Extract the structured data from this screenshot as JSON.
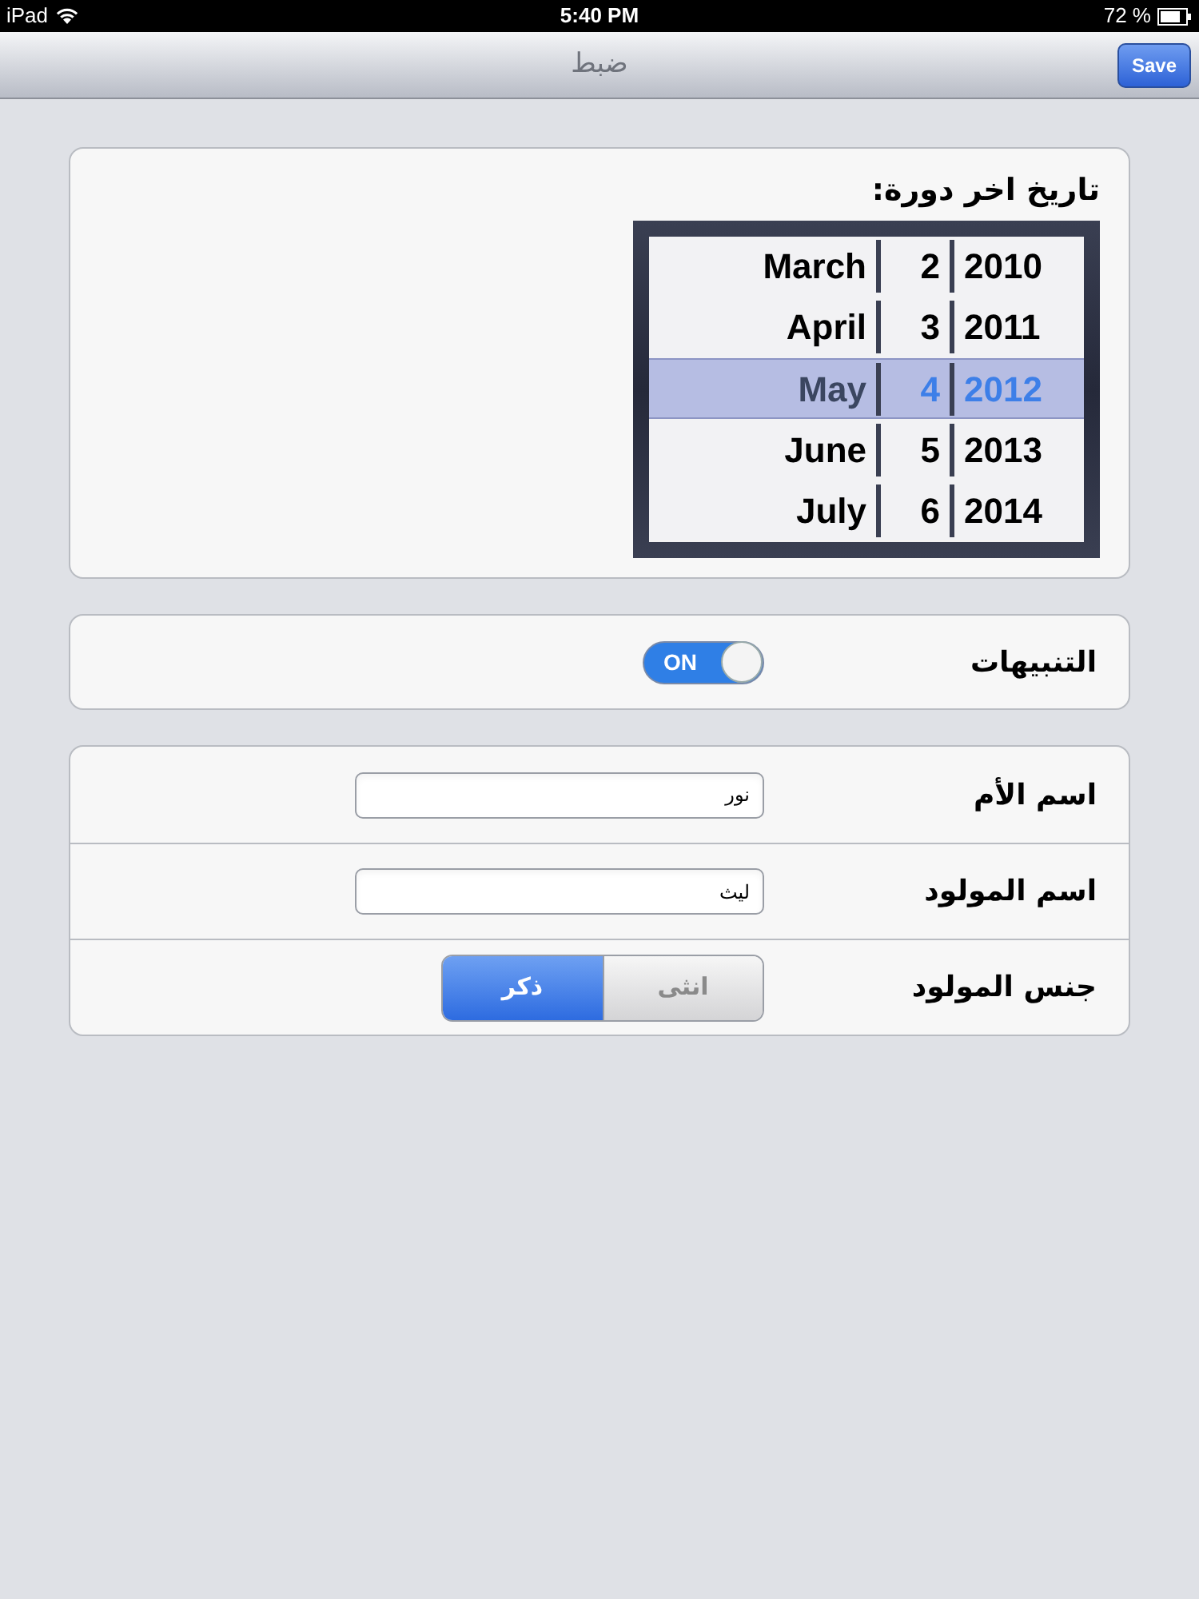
{
  "status_bar": {
    "device": "iPad",
    "time": "5:40 PM",
    "battery": "72 %"
  },
  "nav_bar": {
    "title": "ضبط",
    "save_button": "Save"
  },
  "date_section": {
    "label": "تاريخ اخر دورة:",
    "picker_rows": [
      {
        "month": "March",
        "day": "2",
        "year": "2010",
        "selected": false
      },
      {
        "month": "April",
        "day": "3",
        "year": "2011",
        "selected": false
      },
      {
        "month": "May",
        "day": "4",
        "year": "2012",
        "selected": true
      },
      {
        "month": "June",
        "day": "5",
        "year": "2013",
        "selected": false
      },
      {
        "month": "July",
        "day": "6",
        "year": "2014",
        "selected": false
      }
    ]
  },
  "alerts": {
    "label": "التنبيهات",
    "on": true,
    "switch_text": "ON"
  },
  "form": [
    {
      "kind": "text",
      "label": "اسم الأم",
      "value": "نور"
    },
    {
      "kind": "text",
      "label": "اسم المولود",
      "value": "ليث"
    },
    {
      "kind": "segmented",
      "label": "جنس المولود",
      "options": [
        {
          "label": "انثى",
          "selected": false
        },
        {
          "label": "ذكر",
          "selected": true
        }
      ]
    }
  ]
}
